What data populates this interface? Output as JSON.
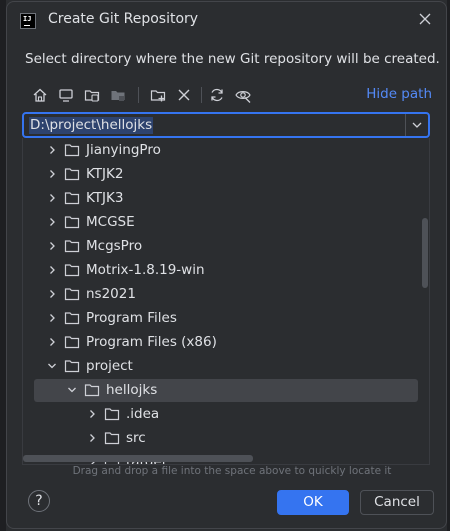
{
  "dialog": {
    "title": "Create Git Repository",
    "description": "Select directory where the new Git repository will be created."
  },
  "toolbar": {
    "hide_path": "Hide path",
    "buttons": [
      "home-icon",
      "desktop-icon",
      "project-folder-icon",
      "module-folder-icon",
      "new-folder-icon",
      "delete-icon",
      "refresh-icon",
      "show-hidden-icon"
    ]
  },
  "path": {
    "value": "D:\\project\\hellojks"
  },
  "tree": {
    "items": [
      {
        "label": "JianyingPro",
        "expanded": false,
        "level": 0
      },
      {
        "label": "KTJK2",
        "expanded": false,
        "level": 0
      },
      {
        "label": "KTJK3",
        "expanded": false,
        "level": 0
      },
      {
        "label": "MCGSE",
        "expanded": false,
        "level": 0
      },
      {
        "label": "McgsPro",
        "expanded": false,
        "level": 0
      },
      {
        "label": "Motrix-1.8.19-win",
        "expanded": false,
        "level": 0
      },
      {
        "label": "ns2021",
        "expanded": false,
        "level": 0
      },
      {
        "label": "Program Files",
        "expanded": false,
        "level": 0
      },
      {
        "label": "Program Files (x86)",
        "expanded": false,
        "level": 0
      },
      {
        "label": "project",
        "expanded": true,
        "level": 0
      },
      {
        "label": "hellojks",
        "expanded": true,
        "level": 1,
        "selected": true
      },
      {
        "label": ".idea",
        "expanded": false,
        "level": 2
      },
      {
        "label": "src",
        "expanded": false,
        "level": 2
      },
      {
        "label": "target",
        "expanded": false,
        "level": 2
      }
    ]
  },
  "hint": "Drag and drop a file into the space above to quickly locate it",
  "footer": {
    "help": "?",
    "ok": "OK",
    "cancel": "Cancel"
  },
  "colors": {
    "accent": "#3574f0",
    "link": "#548af7",
    "background": "#2b2d30",
    "selection": "#43454a"
  }
}
